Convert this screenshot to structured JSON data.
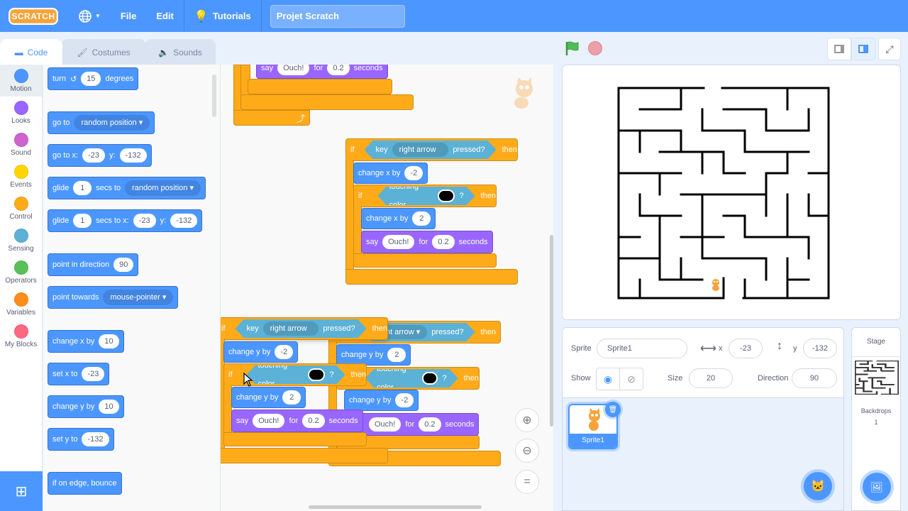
{
  "menubar": {
    "logo": "SCRATCH",
    "file": "File",
    "edit": "Edit",
    "tutorials": "Tutorials",
    "project_title": "Projet Scratch"
  },
  "tabs": [
    {
      "label": "Code",
      "icon": "code-icon",
      "active": true
    },
    {
      "label": "Costumes",
      "icon": "brush-icon",
      "active": false
    },
    {
      "label": "Sounds",
      "icon": "speaker-icon",
      "active": false
    }
  ],
  "categories": [
    {
      "label": "Motion",
      "color": "#4c97ff"
    },
    {
      "label": "Looks",
      "color": "#9966ff"
    },
    {
      "label": "Sound",
      "color": "#cf63cf"
    },
    {
      "label": "Events",
      "color": "#ffd500"
    },
    {
      "label": "Control",
      "color": "#ffab19"
    },
    {
      "label": "Sensing",
      "color": "#5cb1d6"
    },
    {
      "label": "Operators",
      "color": "#59c059"
    },
    {
      "label": "Variables",
      "color": "#ff8c1a"
    },
    {
      "label": "My Blocks",
      "color": "#ff6680"
    }
  ],
  "palette": {
    "turn": {
      "label": "turn",
      "value": "15",
      "suffix": "degrees"
    },
    "goto": {
      "label": "go to",
      "option": "random position"
    },
    "gotoxy": {
      "label": "go to x:",
      "x": "-23",
      "ylabel": "y:",
      "y": "-132"
    },
    "glide1": {
      "label": "glide",
      "secs": "1",
      "mid": "secs to",
      "option": "random position"
    },
    "glide2": {
      "label": "glide",
      "secs": "1",
      "mid": "secs to x:",
      "x": "-23",
      "ylabel": "y:",
      "y": "-132"
    },
    "pointdir": {
      "label": "point in direction",
      "value": "90"
    },
    "pointtow": {
      "label": "point towards",
      "option": "mouse-pointer"
    },
    "changex": {
      "label": "change x by",
      "value": "10"
    },
    "setx": {
      "label": "set x to",
      "value": "-23"
    },
    "changey": {
      "label": "change y by",
      "value": "10"
    },
    "sety": {
      "label": "set y to",
      "value": "-132"
    },
    "bounce": {
      "label": "if on edge, bounce"
    }
  },
  "workspace": {
    "top_say": {
      "say": "say",
      "msg": "Ouch!",
      "for": "for",
      "secs": "0.2",
      "seconds": "seconds"
    },
    "script_right": {
      "if": "if",
      "key": "key",
      "keyopt": "right arrow",
      "pressed": "pressed?",
      "then": "then",
      "change1": "change x by",
      "change1val": "-2",
      "touching": "touching color",
      "q": "?",
      "change2": "change x by",
      "change2val": "2",
      "say": "say",
      "msg": "Ouch!",
      "for": "for",
      "secs": "0.2",
      "seconds": "seconds"
    },
    "script_back": {
      "keyopt": "ght arrow",
      "pressed": "pressed?",
      "then": "then",
      "change1": "change y by",
      "change1val": "2",
      "touching": "touching color",
      "q": "?",
      "change2": "change y by",
      "change2val": "-2",
      "msg": "Ouch!",
      "for": "for",
      "secs": "0.2",
      "seconds": "seconds"
    },
    "script_front": {
      "if": "if",
      "key": "key",
      "keyopt": "right arrow",
      "pressed": "pressed?",
      "then": "then",
      "change1": "change y by",
      "change1val": "-2",
      "touching": "touching color",
      "q": "?",
      "change2": "change y by",
      "change2val": "2",
      "say": "say",
      "msg": "Ouch!",
      "for": "for",
      "secs": "0.2",
      "seconds": "seconds"
    }
  },
  "sprite_info": {
    "sprite_label": "Sprite",
    "sprite_name": "Sprite1",
    "x_label": "x",
    "x": "-23",
    "y_label": "y",
    "y": "-132",
    "show_label": "Show",
    "size_label": "Size",
    "size": "20",
    "direction_label": "Direction",
    "direction": "90"
  },
  "sprites": [
    {
      "name": "Sprite1",
      "selected": true
    }
  ],
  "stage_panel": {
    "title": "Stage",
    "backdrops_label": "Backdrops",
    "backdrops_count": "1"
  }
}
